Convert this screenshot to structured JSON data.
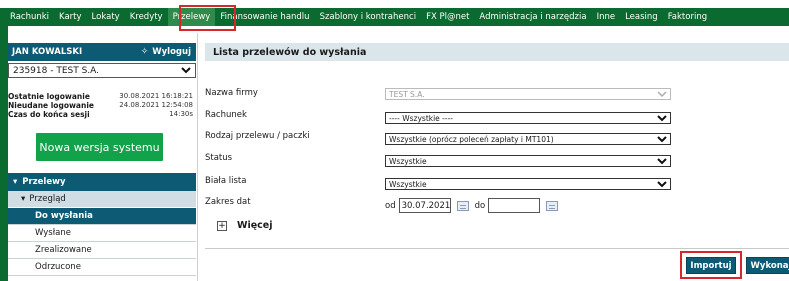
{
  "nav": {
    "items": [
      {
        "label": "Rachunki"
      },
      {
        "label": "Karty"
      },
      {
        "label": "Lokaty"
      },
      {
        "label": "Kredyty"
      },
      {
        "label": "Przelewy"
      },
      {
        "label": "Finansowanie handlu"
      },
      {
        "label": "Szablony i kontrahenci"
      },
      {
        "label": "FX Pl@net"
      },
      {
        "label": "Administracja i narzędzia"
      },
      {
        "label": "Inne"
      },
      {
        "label": "Leasing"
      },
      {
        "label": "Faktoring"
      }
    ],
    "active": "Przelewy",
    "highlight_color": "#d8262d"
  },
  "sidebar": {
    "user_name": "JAN KOWALSKI",
    "logout_label": "Wyloguj",
    "account": "235918 - TEST S.A.",
    "login_info": [
      {
        "label": "Ostatnie logowanie",
        "value": "30.08.2021 16:18:21"
      },
      {
        "label": "Nieudane logowanie",
        "value": "24.08.2021 12:54:08"
      },
      {
        "label": "Czas do końca sesji",
        "value": "14:30s"
      }
    ],
    "new_version_label": "Nowa wersja systemu",
    "menu_main": "Przelewy",
    "menu_sub": "Przegląd",
    "menu_items": [
      {
        "label": "Do wysłania"
      },
      {
        "label": "Wysłane"
      },
      {
        "label": "Zrealizowane"
      },
      {
        "label": "Odrzucone"
      }
    ]
  },
  "main": {
    "title": "Lista przelewów do wysłania",
    "fields": {
      "company": {
        "label": "Nazwa firmy",
        "value": "TEST S.A."
      },
      "account": {
        "label": "Rachunek",
        "value": "---- Wszystkie ----"
      },
      "type": {
        "label": "Rodzaj przelewu / paczki",
        "value": "Wszystkie (oprócz poleceń zapłaty i MT101)"
      },
      "status": {
        "label": "Status",
        "value": "Wszystkie"
      },
      "whitelist": {
        "label": "Biała lista",
        "value": "Wszystkie"
      },
      "date": {
        "label": "Zakres dat",
        "from_label": "od",
        "from_value": "30.07.2021",
        "to_label": "do",
        "to_value": ""
      }
    },
    "more_label": "Więcej",
    "import_label": "Importuj",
    "execute_label": "Wykonaj"
  },
  "colors": {
    "brand_green": "#0a6a2f",
    "accent_teal": "#0d5a75",
    "button_green": "#12a24a",
    "highlight_red": "#d8262d"
  }
}
